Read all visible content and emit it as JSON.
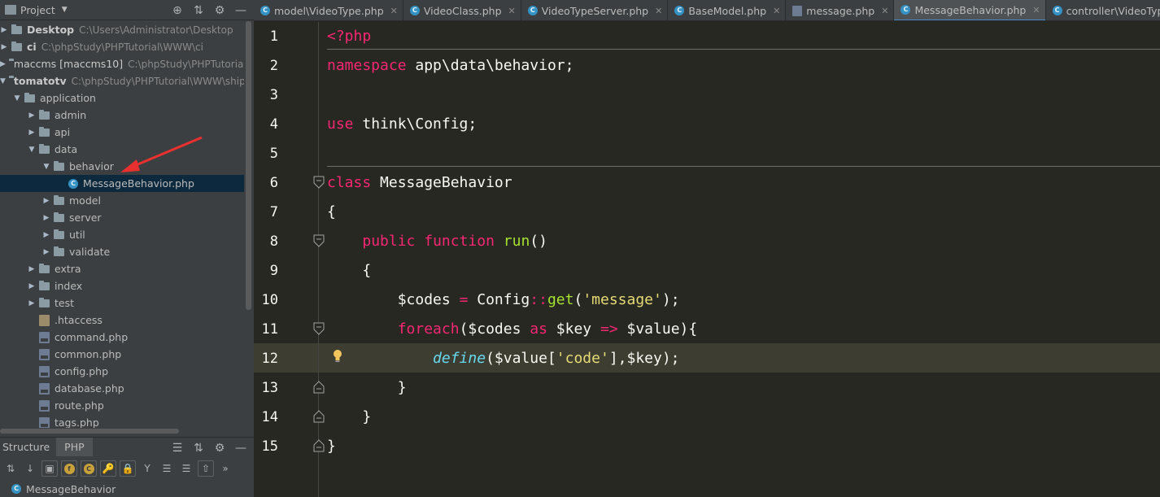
{
  "project_panel": {
    "title": "Project",
    "tree": [
      {
        "name": "Desktop",
        "path": "C:\\Users\\Administrator\\Desktop",
        "bold": true
      },
      {
        "name": "ci",
        "path": "C:\\phpStudy\\PHPTutorial\\WWW\\ci",
        "bold": true
      },
      {
        "name": "maccms [maccms10]",
        "path": "C:\\phpStudy\\PHPTutorial\\",
        "bold": false
      },
      {
        "name": "tomatotv",
        "path": "C:\\phpStudy\\PHPTutorial\\WWW\\ship",
        "bold": true
      },
      {
        "name": "application"
      },
      {
        "name": "admin"
      },
      {
        "name": "api"
      },
      {
        "name": "data"
      },
      {
        "name": "behavior"
      },
      {
        "name": "MessageBehavior.php"
      },
      {
        "name": "model"
      },
      {
        "name": "server"
      },
      {
        "name": "util"
      },
      {
        "name": "validate"
      },
      {
        "name": "extra"
      },
      {
        "name": "index"
      },
      {
        "name": "test"
      },
      {
        "name": ".htaccess"
      },
      {
        "name": "command.php"
      },
      {
        "name": "common.php"
      },
      {
        "name": "config.php"
      },
      {
        "name": "database.php"
      },
      {
        "name": "route.php"
      },
      {
        "name": "tags.php"
      }
    ]
  },
  "structure_panel": {
    "tab_structure": "Structure",
    "tab_php": "PHP",
    "item": "MessageBehavior",
    "overflow": "»"
  },
  "icons": {
    "class_letter": "C",
    "field_letter": "f"
  },
  "tabs": [
    {
      "label": "model\\VideoType.php",
      "icon": "class",
      "active": false
    },
    {
      "label": "VideoClass.php",
      "icon": "class",
      "active": false
    },
    {
      "label": "VideoTypeServer.php",
      "icon": "class",
      "active": false
    },
    {
      "label": "BaseModel.php",
      "icon": "class",
      "active": false
    },
    {
      "label": "message.php",
      "icon": "php",
      "active": false
    },
    {
      "label": "MessageBehavior.php",
      "icon": "class",
      "active": true
    },
    {
      "label": "controller\\VideoType.php",
      "icon": "class",
      "active": false
    }
  ],
  "editor": {
    "line_numbers": [
      "1",
      "2",
      "3",
      "4",
      "5",
      "6",
      "7",
      "8",
      "9",
      "10",
      "11",
      "12",
      "13",
      "14",
      "15"
    ],
    "code": {
      "l1": "<?php",
      "l2_kw": "namespace",
      "l2_rest": " app\\data\\behavior;",
      "l4_kw": "use",
      "l4_rest": " think\\Config;",
      "l6_kw": "class",
      "l6_rest": " MessageBehavior",
      "l7": "{",
      "l8_indent": "    ",
      "l8_kw1": "public",
      "l8_sp": " ",
      "l8_kw2": "function",
      "l8_sp2": " ",
      "l8_fn": "run",
      "l8_rest": "()",
      "l9": "    {",
      "l10_a": "        $codes ",
      "l10_op": "=",
      "l10_b": " Config",
      "l10_dc": "::",
      "l10_fn": "get",
      "l10_c": "(",
      "l10_str": "'message'",
      "l10_d": ");",
      "l11_indent": "        ",
      "l11_kw": "foreach",
      "l11_a": "($codes ",
      "l11_as": "as",
      "l11_b": " $key ",
      "l11_arrow": "=>",
      "l11_c": " $value){",
      "l12_indent": "            ",
      "l12_fn": "define",
      "l12_a": "($value[",
      "l12_str": "'code'",
      "l12_b": "],$key);",
      "l13": "        }",
      "l14": "    }",
      "l15": "}"
    }
  },
  "colors": {
    "keyword": "#f92672",
    "function": "#a6e22e",
    "string": "#e6db74",
    "builtin": "#66d9ef",
    "text": "#f8f8f2",
    "background": "#272822",
    "current_line": "#3e3d32",
    "selection_row": "#0d293e",
    "annotation_arrow": "#e8312f"
  }
}
